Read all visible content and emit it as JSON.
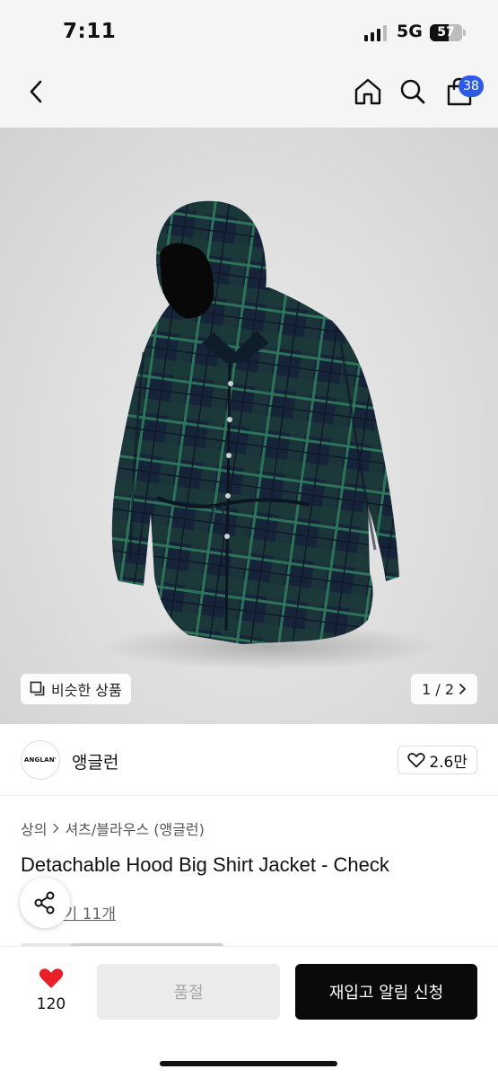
{
  "status_bar": {
    "time": "7:11",
    "network": "5G",
    "battery": "57",
    "battery_level": 0.57
  },
  "top_nav": {
    "back_icon": "chevron-left-icon",
    "home_icon": "home-icon",
    "search_icon": "search-icon",
    "cart_icon": "shopping-bag-icon",
    "cart_count": "38",
    "badge_color": "#2d5be3"
  },
  "product_image": {
    "similar_label": "비슷한 상품",
    "pager": "1 / 2"
  },
  "brand": {
    "logo_text": "ANGLAN'",
    "name": "앵글런",
    "likes": "2.6만"
  },
  "breadcrumb": {
    "category": "상의",
    "subcategory": "셔츠/블라우스 (앵글런)"
  },
  "product": {
    "title": "Detachable Hood Big Shirt Jacket - Check",
    "review_link": "후기 11개",
    "review_visible": "기 11개"
  },
  "bottom_bar": {
    "wish_count": "120",
    "soldout_label": "품절",
    "restock_label": "재입고 알림 신청",
    "heart_color": "#e8202a",
    "primary_color": "#0a0a0a"
  }
}
